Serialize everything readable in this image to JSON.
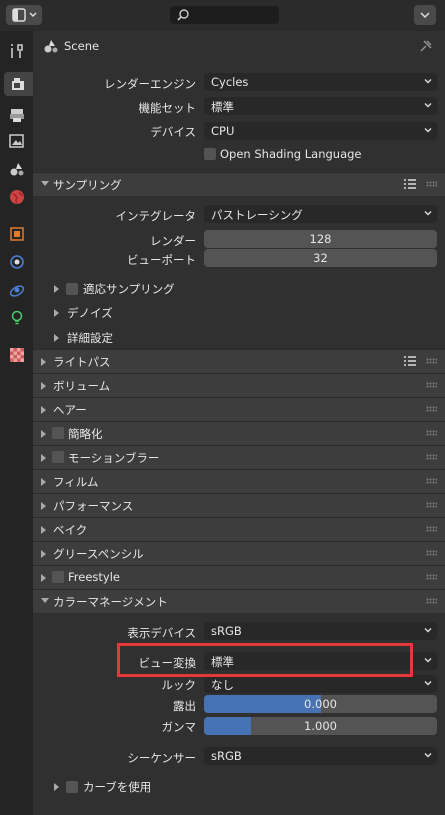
{
  "header": {
    "search_placeholder": ""
  },
  "context": {
    "scene_label": "Scene"
  },
  "render": {
    "engine_label": "レンダーエンジン",
    "engine_value": "Cycles",
    "featureset_label": "機能セット",
    "featureset_value": "標準",
    "device_label": "デバイス",
    "device_value": "CPU",
    "osl_label": "Open Shading Language"
  },
  "sampling": {
    "title": "サンプリング",
    "integrator_label": "インテグレータ",
    "integrator_value": "パストレーシング",
    "render_label": "レンダー",
    "render_value": "128",
    "viewport_label": "ビューポート",
    "viewport_value": "32",
    "sub": [
      "適応サンプリング",
      "デノイズ",
      "詳細設定"
    ]
  },
  "panels": [
    "ライトパス",
    "ボリューム",
    "ヘアー",
    "簡略化",
    "モーションブラー",
    "フィルム",
    "パフォーマンス",
    "ベイク",
    "グリースペンシル",
    "Freestyle"
  ],
  "color_management": {
    "title": "カラーマネージメント",
    "display_label": "表示デバイス",
    "display_value": "sRGB",
    "view_label": "ビュー変換",
    "view_value": "標準",
    "look_label": "ルック",
    "look_value": "なし",
    "exposure_label": "露出",
    "exposure_value": "0.000",
    "exposure_fill": 0.5,
    "gamma_label": "ガンマ",
    "gamma_value": "1.000",
    "gamma_fill": 0.2,
    "sequencer_label": "シーケンサー",
    "sequencer_value": "sRGB",
    "curves_label": "カーブを使用"
  },
  "colors": {
    "accent": "#4772b3",
    "highlight_box": "#e53935"
  }
}
